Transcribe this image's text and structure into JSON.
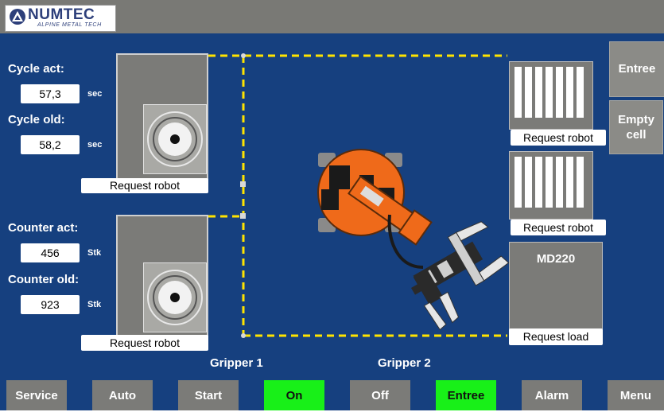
{
  "logo": {
    "brand": "NUMTEC",
    "tagline": "ALPINE METAL TECH"
  },
  "stats": {
    "cycle_act_label": "Cycle act:",
    "cycle_act_value": "57,3",
    "cycle_act_unit": "sec",
    "cycle_old_label": "Cycle old:",
    "cycle_old_value": "58,2",
    "cycle_old_unit": "sec",
    "counter_act_label": "Counter act:",
    "counter_act_value": "456",
    "counter_act_unit": "Stk",
    "counter_old_label": "Counter old:",
    "counter_old_value": "923",
    "counter_old_unit": "Stk"
  },
  "machines": {
    "machine1_request": "Request robot",
    "machine2_request": "Request robot",
    "rack1_request": "Request robot",
    "rack2_request": "Request robot",
    "md_label": "MD220",
    "md_request": "Request load"
  },
  "side_buttons": {
    "entree": "Entree",
    "empty_cell": "Empty cell"
  },
  "grippers": {
    "gripper1": "Gripper 1",
    "gripper2": "Gripper 2"
  },
  "bottom_buttons": [
    {
      "label": "Service",
      "color": "#7b7b78"
    },
    {
      "label": "Auto",
      "color": "#7b7b78"
    },
    {
      "label": "Start",
      "color": "#7b7b78"
    },
    {
      "label": "On",
      "color": "#18f018"
    },
    {
      "label": "Off",
      "color": "#7b7b78"
    },
    {
      "label": "Entree",
      "color": "#18f018"
    },
    {
      "label": "Alarm",
      "color": "#7b7b78"
    },
    {
      "label": "Menu",
      "color": "#7b7b78"
    }
  ],
  "colors": {
    "background": "#16407f",
    "active_green": "#18f018",
    "fence": "#ffe400",
    "robot": "#ef6a1a"
  },
  "icons": {
    "logo": "numtec-logo",
    "robot": "robot-arm-icon"
  }
}
